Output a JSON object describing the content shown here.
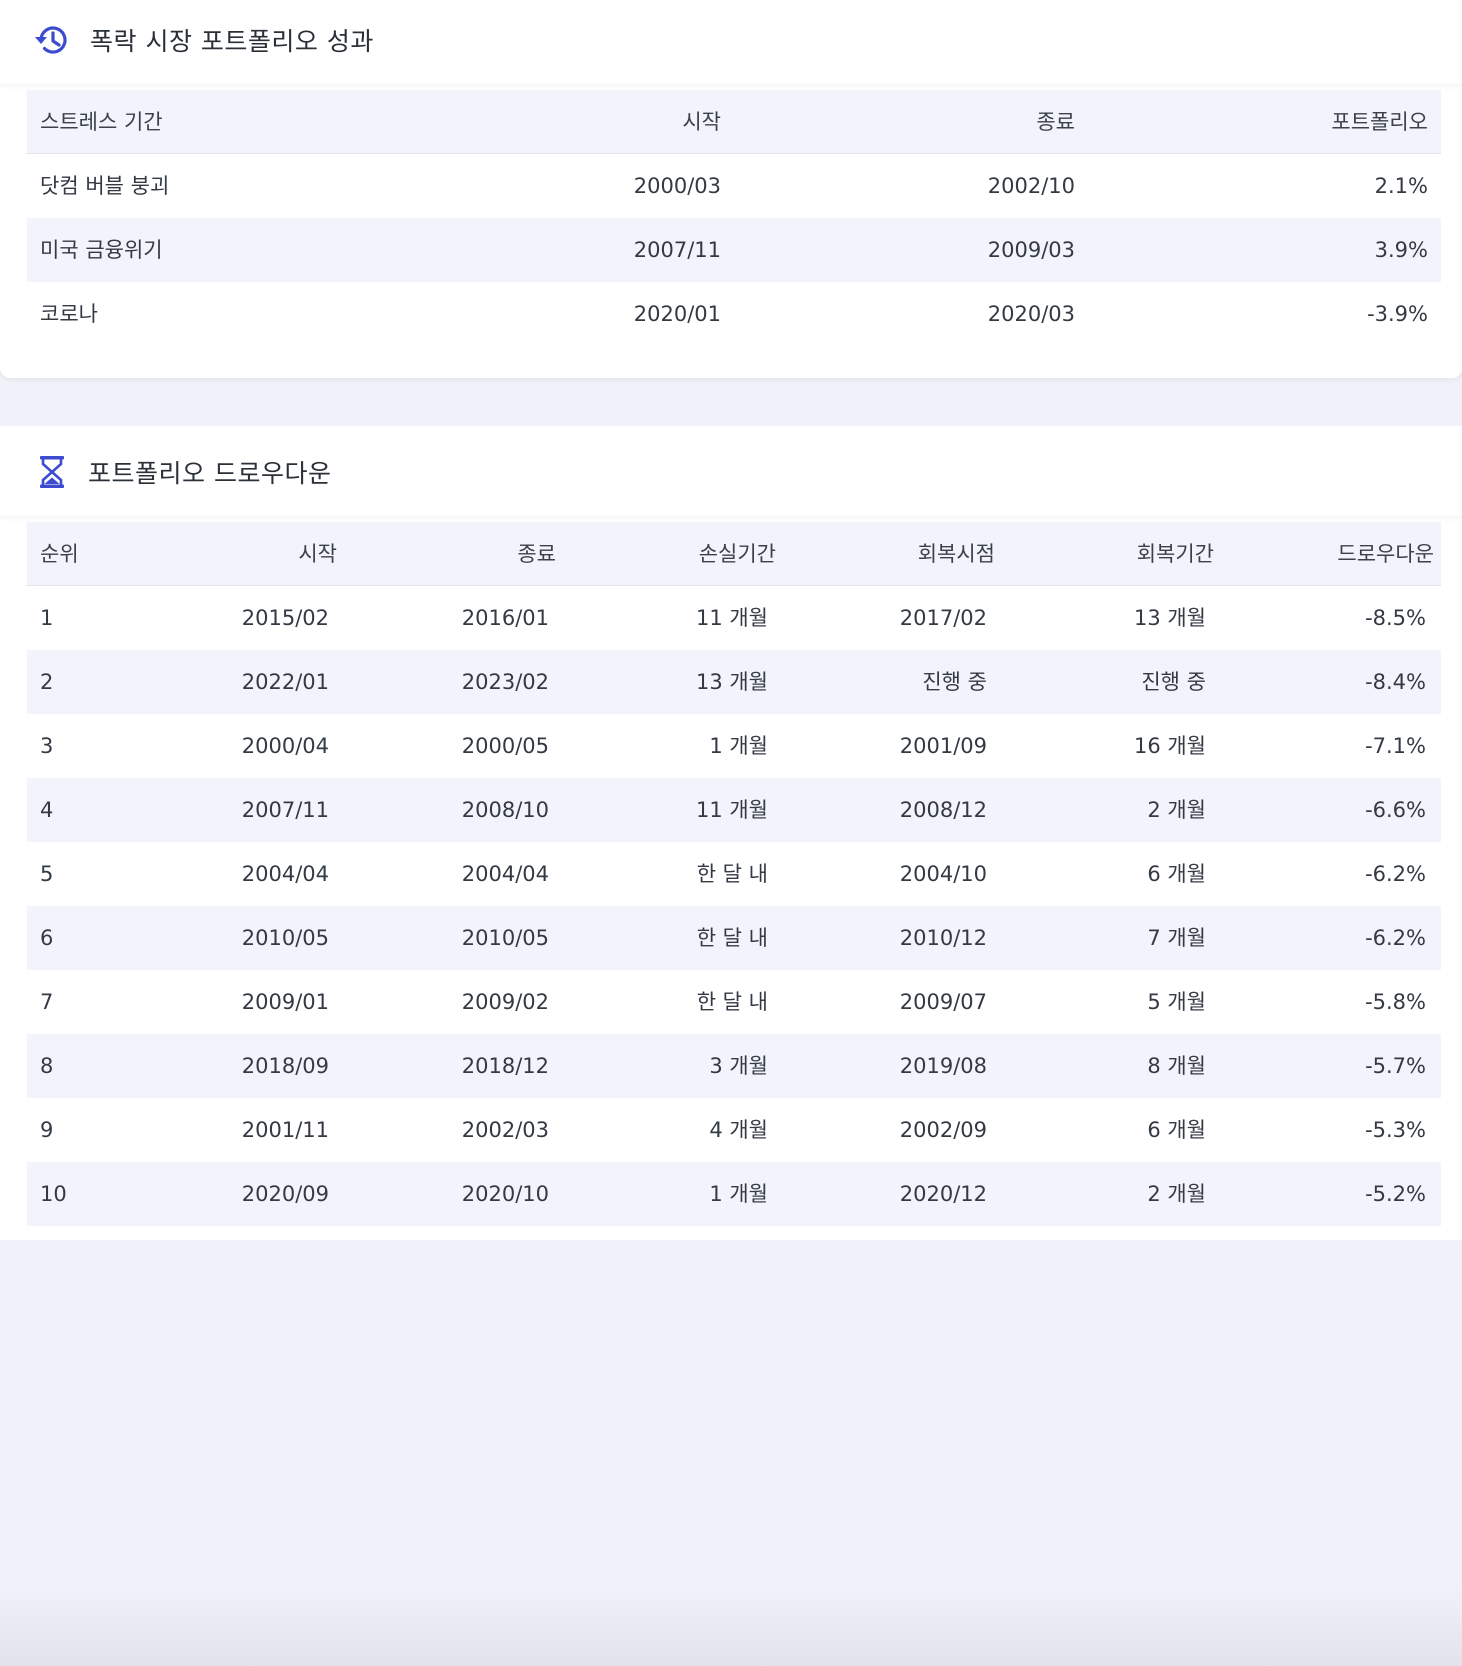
{
  "stress": {
    "title": "폭락 시장 포트폴리오 성과",
    "columns": [
      "스트레스 기간",
      "시작",
      "종료",
      "포트폴리오"
    ],
    "rows": [
      [
        "닷컴 버블 붕괴",
        "2000/03",
        "2002/10",
        "2.1%"
      ],
      [
        "미국 금융위기",
        "2007/11",
        "2009/03",
        "3.9%"
      ],
      [
        "코로나",
        "2020/01",
        "2020/03",
        "-3.9%"
      ]
    ]
  },
  "drawdown": {
    "title": "포트폴리오 드로우다운",
    "columns": [
      "순위",
      "시작",
      "종료",
      "손실기간",
      "회복시점",
      "회복기간",
      "드로우다운"
    ],
    "rows": [
      [
        "1",
        "2015/02",
        "2016/01",
        "11 개월",
        "2017/02",
        "13 개월",
        "-8.5%"
      ],
      [
        "2",
        "2022/01",
        "2023/02",
        "13 개월",
        "진행 중",
        "진행 중",
        "-8.4%"
      ],
      [
        "3",
        "2000/04",
        "2000/05",
        "1 개월",
        "2001/09",
        "16 개월",
        "-7.1%"
      ],
      [
        "4",
        "2007/11",
        "2008/10",
        "11 개월",
        "2008/12",
        "2 개월",
        "-6.6%"
      ],
      [
        "5",
        "2004/04",
        "2004/04",
        "한 달 내",
        "2004/10",
        "6 개월",
        "-6.2%"
      ],
      [
        "6",
        "2010/05",
        "2010/05",
        "한 달 내",
        "2010/12",
        "7 개월",
        "-6.2%"
      ],
      [
        "7",
        "2009/01",
        "2009/02",
        "한 달 내",
        "2009/07",
        "5 개월",
        "-5.8%"
      ],
      [
        "8",
        "2018/09",
        "2018/12",
        "3 개월",
        "2019/08",
        "8 개월",
        "-5.7%"
      ],
      [
        "9",
        "2001/11",
        "2002/03",
        "4 개월",
        "2002/09",
        "6 개월",
        "-5.3%"
      ],
      [
        "10",
        "2020/09",
        "2020/10",
        "1 개월",
        "2020/12",
        "2 개월",
        "-5.2%"
      ]
    ]
  },
  "icons": {
    "stress": "history-icon",
    "drawdown": "hourglass-icon"
  },
  "colors": {
    "accent": "#3d4bd0",
    "row_alt": "#f3f4fb",
    "page_bg": "#f1f2f9"
  }
}
